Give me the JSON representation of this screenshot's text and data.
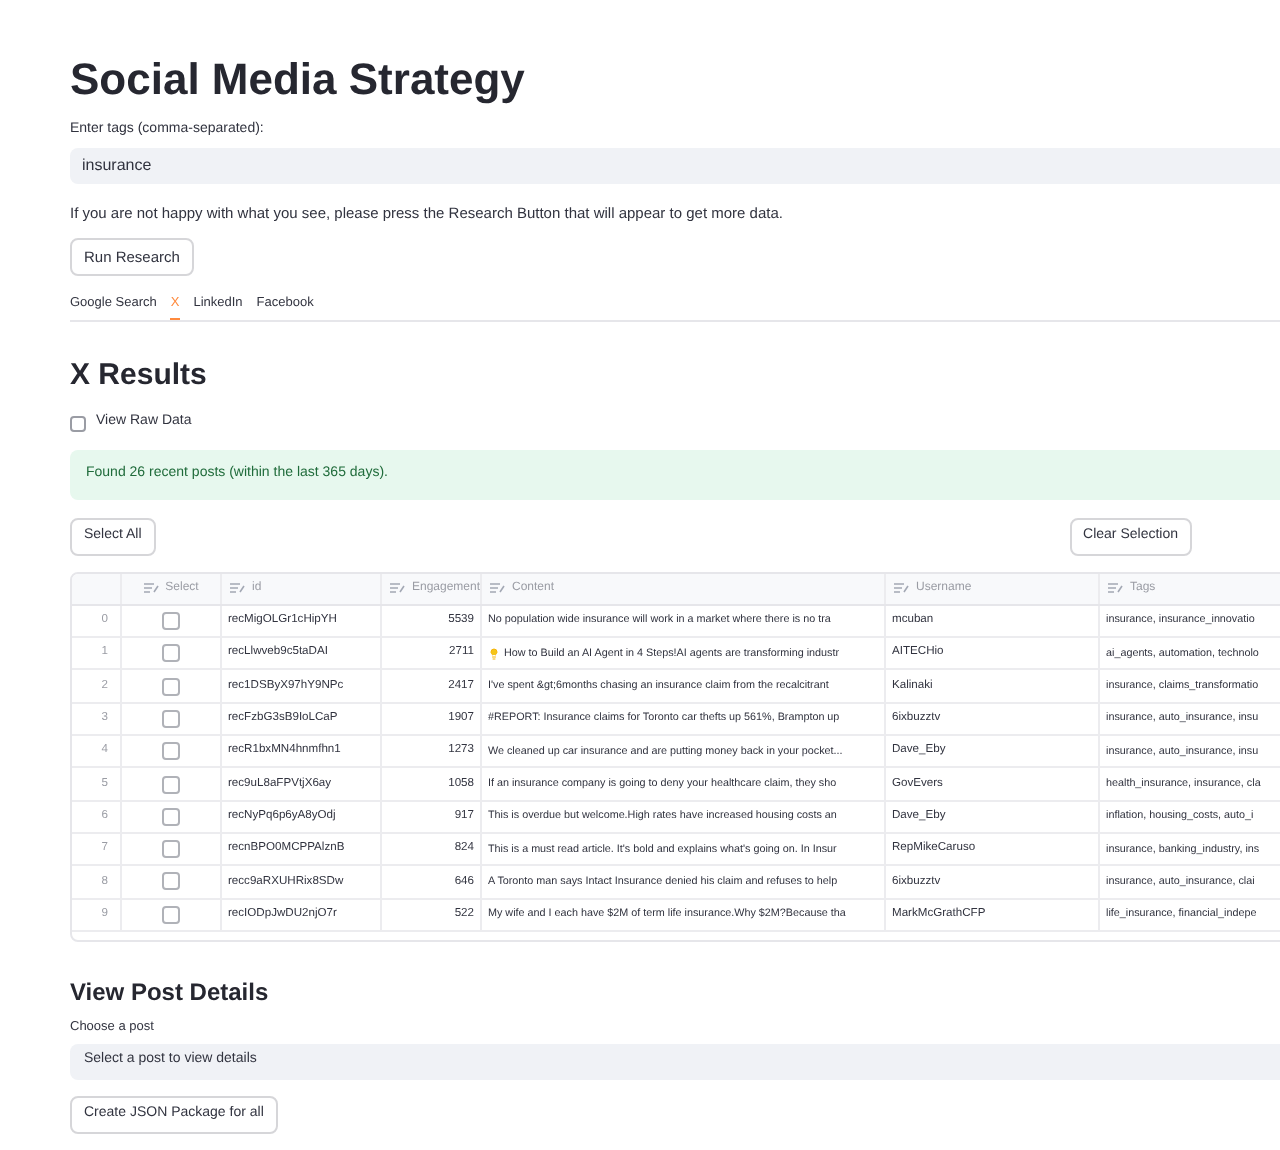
{
  "title": "Social Media Strategy",
  "tags_field": {
    "label": "Enter tags (comma-separated):",
    "value": "insurance"
  },
  "info_text": "If you are not happy with what you see, please press the Research Button that will appear to get more data.",
  "run_button": "Run Research",
  "tabs": [
    {
      "label": "Google Search",
      "selected": false
    },
    {
      "label": "X",
      "selected": true
    },
    {
      "label": "LinkedIn",
      "selected": false
    },
    {
      "label": "Facebook",
      "selected": false
    }
  ],
  "results_heading": "X Results",
  "raw_data": {
    "label": "View Raw Data",
    "checked": false
  },
  "alert": "Found 26 recent posts (within the last 365 days).",
  "select_all": "Select All",
  "clear_selection": "Clear Selection",
  "table": {
    "columns": [
      "Select",
      "id",
      "Engagement",
      "Content",
      "Username",
      "Tags"
    ],
    "rows": [
      {
        "index": "0",
        "checked": false,
        "id": "recMigOLGr1cHipYH",
        "engagement": "5539",
        "content": "No population wide insurance  will work in a market where there is no tra",
        "username": "mcuban",
        "tags": "insurance, insurance_innovatio"
      },
      {
        "index": "1",
        "checked": false,
        "id": "recLlwveb9c5taDAI",
        "engagement": "2711",
        "kind": "bulb",
        "content": "How to Build an AI Agent in 4 Steps!AI agents are transforming industr",
        "username": "AITECHio",
        "tags": "ai_agents, automation, technolo"
      },
      {
        "index": "2",
        "checked": false,
        "id": "rec1DSByX97hY9NPc",
        "engagement": "2417",
        "content": "I've spent &gt;6months chasing an insurance claim from the recalcitrant",
        "username": "Kalinaki",
        "tags": "insurance, claims_transformatio"
      },
      {
        "index": "3",
        "checked": false,
        "id": "recFzbG3sB9IoLCaP",
        "engagement": "1907",
        "content": "#REPORT: Insurance claims for Toronto car thefts up 561%, Brampton up",
        "username": "6ixbuzztv",
        "tags": "insurance, auto_insurance, insu"
      },
      {
        "index": "4",
        "checked": false,
        "id": "recR1bxMN4hnmfhn1",
        "engagement": "1273",
        "content": "We cleaned up car insurance and are putting money back in your pocket...",
        "username": "Dave_Eby",
        "tags": "insurance, auto_insurance, insu"
      },
      {
        "index": "5",
        "checked": false,
        "id": "rec9uL8aFPVtjX6ay",
        "engagement": "1058",
        "content": "If an insurance company is going to deny your healthcare claim, they sho",
        "username": "GovEvers",
        "tags": "health_insurance, insurance, cla"
      },
      {
        "index": "6",
        "checked": false,
        "id": "recNyPq6p6yA8yOdj",
        "engagement": "917",
        "content": "This is overdue but welcome.High rates have increased housing costs an",
        "username": "Dave_Eby",
        "tags": "inflation, housing_costs, auto_i"
      },
      {
        "index": "7",
        "checked": false,
        "id": "recnBPO0MCPPAlznB",
        "engagement": "824",
        "content": "This is a must read article. It's bold and explains what's going on. In Insur",
        "username": "RepMikeCaruso",
        "tags": "insurance, banking_industry, ins"
      },
      {
        "index": "8",
        "checked": false,
        "id": "recc9aRXUHRix8SDw",
        "engagement": "646",
        "content": "A Toronto man says Intact Insurance denied his claim and refuses to help",
        "username": "6ixbuzztv",
        "tags": "insurance, auto_insurance, clai"
      },
      {
        "index": "9",
        "checked": false,
        "id": "recIODpJwDU2njO7r",
        "engagement": "522",
        "content": "My wife and I each have $2M of term life insurance.Why $2M?Because tha",
        "username": "MarkMcGrathCFP",
        "tags": "life_insurance, financial_indepe"
      }
    ]
  },
  "details_heading": "View Post Details",
  "post_select": {
    "label": "Choose a post",
    "placeholder": "Select a post to view details"
  },
  "json_button": "Create JSON Package for all"
}
